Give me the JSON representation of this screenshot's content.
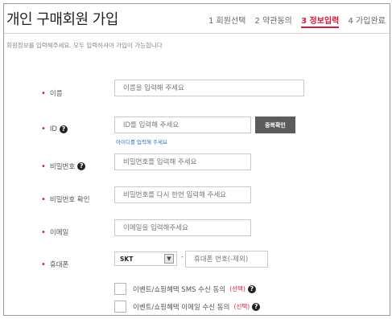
{
  "header": {
    "title": "개인 구매회원 가입",
    "steps": [
      {
        "label": "1 회원선택",
        "active": false
      },
      {
        "label": "2 약관동의",
        "active": false
      },
      {
        "label": "3 정보입력",
        "active": true
      },
      {
        "label": "4 가입완료",
        "active": false
      }
    ]
  },
  "notice": "회원정보를 입력해주세요. 모두 입력하셔야 가입이 가능합니다",
  "form": {
    "name": {
      "label": "이름",
      "placeholder": "이름을 입력해 주세요"
    },
    "id": {
      "label": "ID",
      "placeholder": "ID를 입력해 주세요",
      "check_button": "중복확인",
      "hint": "아이디를 입력해 주세요"
    },
    "password": {
      "label": "비밀번호",
      "placeholder": "비밀번호를 입력해 주세요"
    },
    "password_confirm": {
      "label": "비밀번호 확인",
      "placeholder": "비밀번호를 다시 한번 입력해 주세요"
    },
    "email": {
      "label": "이메일",
      "placeholder": "이메일을 입력해주세요"
    },
    "phone": {
      "label": "휴대폰",
      "carrier": "SKT",
      "separator": "-",
      "placeholder": "휴대폰 번호(-제외)"
    },
    "consent_sms": {
      "label": "이벤트/쇼핑혜택 SMS 수신 동의",
      "optional": "(선택)"
    },
    "consent_email": {
      "label": "이벤트/쇼핑혜택 이메일 수신 동의",
      "optional": "(선택)"
    }
  },
  "icons": {
    "required": "bullet-dot",
    "help": "question-circle-icon"
  },
  "colors": {
    "accent": "#d31b3a",
    "button": "#5b5b5b",
    "link": "#2e6cc4"
  }
}
